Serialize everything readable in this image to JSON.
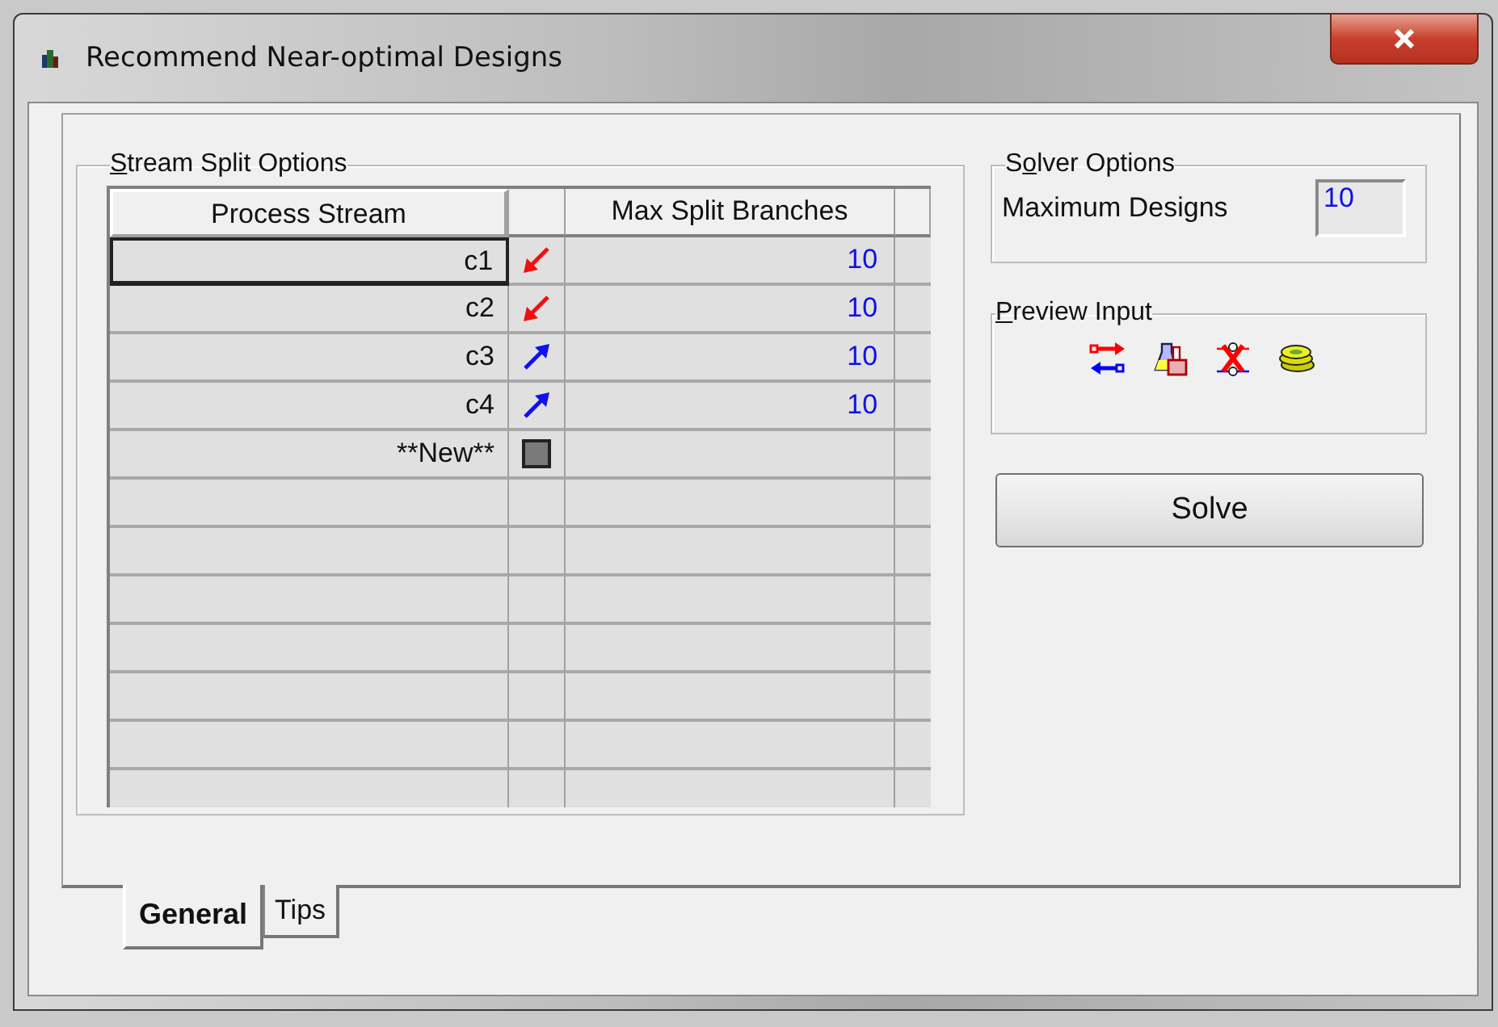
{
  "window": {
    "title": "Recommend Near-optimal Designs"
  },
  "stream_split_options": {
    "label": {
      "access_key": "S",
      "rest": "tream Split Options"
    },
    "columns": [
      "Process Stream",
      "Max Split Branches"
    ],
    "rows": [
      {
        "name": "c1",
        "kind": "hot",
        "value": "10",
        "selected": true
      },
      {
        "name": "c2",
        "kind": "hot",
        "value": "10",
        "selected": false
      },
      {
        "name": "c3",
        "kind": "cold",
        "value": "10",
        "selected": false
      },
      {
        "name": "c4",
        "kind": "cold",
        "value": "10",
        "selected": false
      },
      {
        "name": "**New**",
        "kind": "new",
        "selected": false
      }
    ]
  },
  "solver_options": {
    "label": {
      "lead": "S",
      "access_key": "o",
      "rest": "lver Options"
    },
    "field_label": "Maximum Designs",
    "field_value": "10"
  },
  "preview_input": {
    "label": {
      "access_key": "P",
      "rest": "review Input"
    },
    "tools": [
      {
        "kind": "streams"
      },
      {
        "kind": "equipment"
      },
      {
        "kind": "forbidden"
      },
      {
        "kind": "costs"
      }
    ]
  },
  "solve_button": "Solve",
  "tabs": [
    {
      "label": "General",
      "selected": true
    },
    {
      "label": "Tips",
      "selected": false
    }
  ]
}
